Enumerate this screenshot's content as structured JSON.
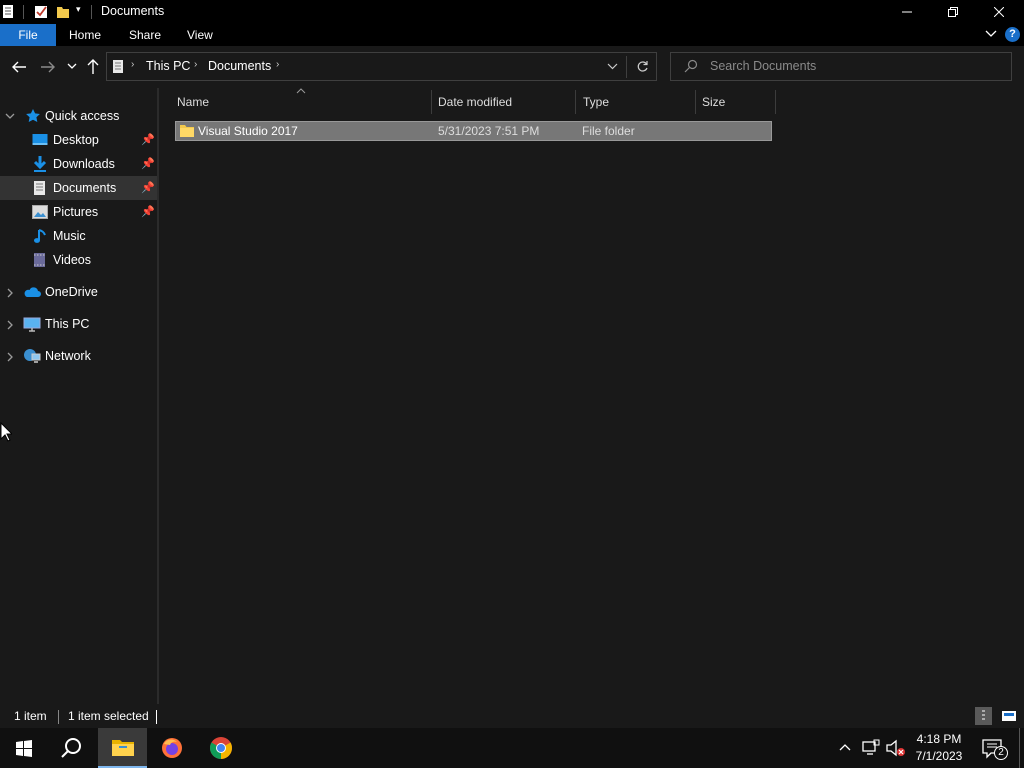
{
  "window": {
    "title": "Documents"
  },
  "ribbon": {
    "tabs": [
      "File",
      "Home",
      "Share",
      "View"
    ],
    "active_color": "#1a6fc9"
  },
  "address": {
    "breadcrumb": [
      "This PC",
      "Documents"
    ],
    "search_placeholder": "Search Documents"
  },
  "nav": {
    "quick_access": "Quick access",
    "items": [
      "Desktop",
      "Downloads",
      "Documents",
      "Pictures",
      "Music",
      "Videos"
    ],
    "roots": [
      "OneDrive",
      "This PC",
      "Network"
    ]
  },
  "columns": [
    "Name",
    "Date modified",
    "Type",
    "Size"
  ],
  "files": [
    {
      "name": "Visual Studio 2017",
      "date": "5/31/2023 7:51 PM",
      "type": "File folder",
      "size": ""
    }
  ],
  "status": {
    "count": "1 item",
    "selected": "1 item selected"
  },
  "taskbar": {
    "time": "4:18 PM",
    "date": "7/1/2023",
    "notifications": "2"
  }
}
